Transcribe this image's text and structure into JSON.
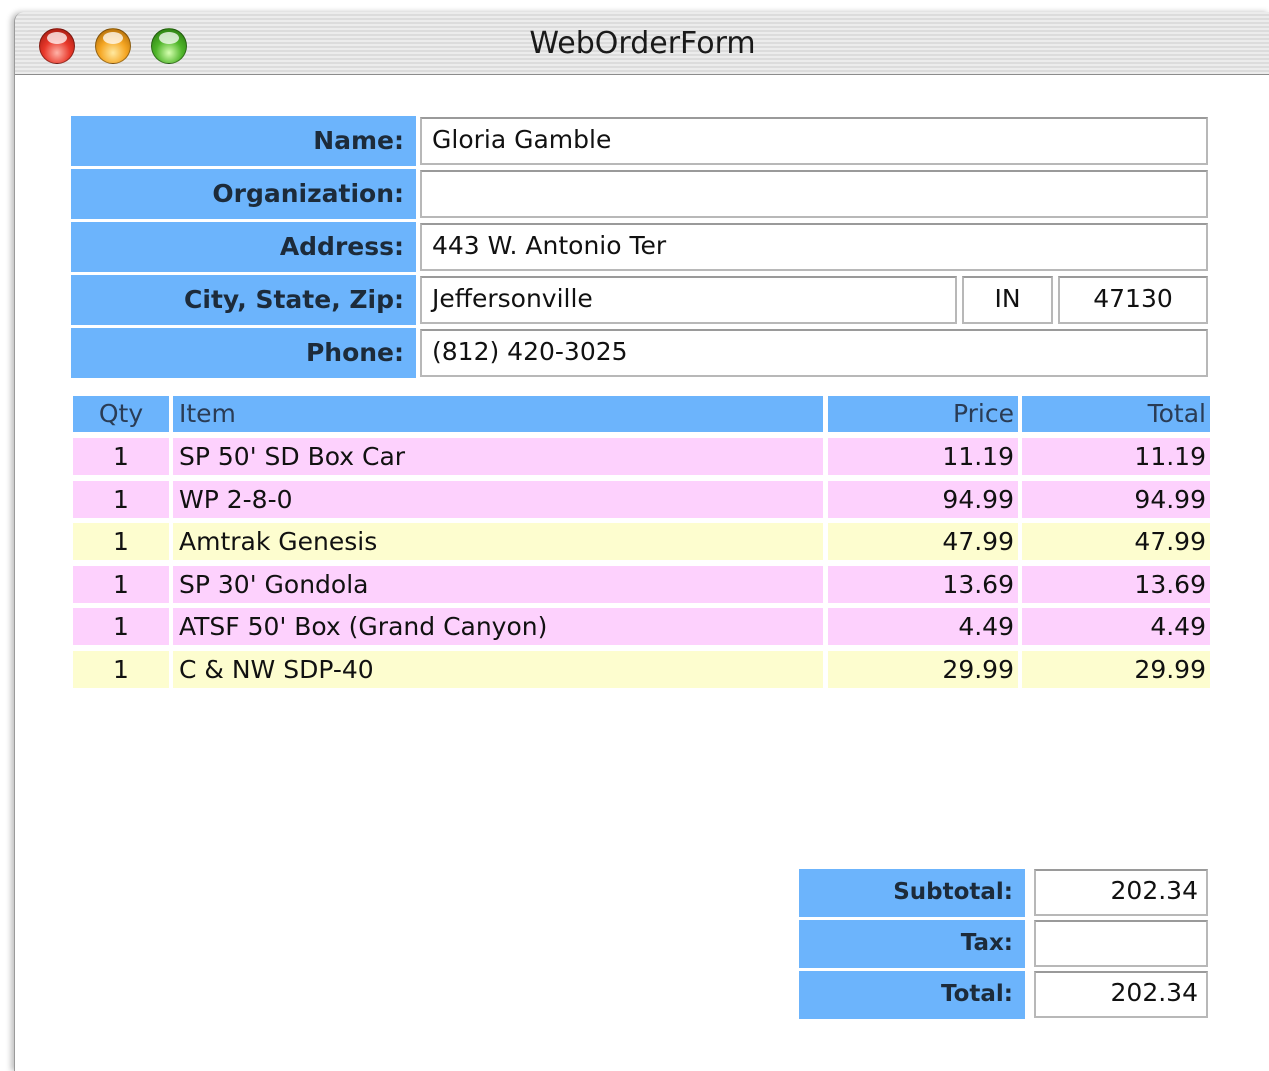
{
  "window": {
    "title": "WebOrderForm"
  },
  "customer": {
    "name_label": "Name:",
    "name_value": "Gloria Gamble",
    "organization_label": "Organization:",
    "organization_value": "",
    "address_label": "Address:",
    "address_value": "443 W. Antonio Ter",
    "csz_label": "City, State, Zip:",
    "city_value": "Jeffersonville",
    "state_value": "IN",
    "zip_value": "47130",
    "phone_label": "Phone:",
    "phone_value": "(812) 420-3025"
  },
  "items": {
    "headers": {
      "qty": "Qty",
      "item": "Item",
      "price": "Price",
      "total": "Total"
    },
    "rows": [
      {
        "qty": "1",
        "item": "SP 50' SD Box Car",
        "price": "11.19",
        "total": "11.19",
        "color": "#fdd1fd"
      },
      {
        "qty": "1",
        "item": "WP 2-8-0",
        "price": "94.99",
        "total": "94.99",
        "color": "#fdd1fd"
      },
      {
        "qty": "1",
        "item": "Amtrak Genesis",
        "price": "47.99",
        "total": "47.99",
        "color": "#fdfdcf"
      },
      {
        "qty": "1",
        "item": "SP 30' Gondola",
        "price": "13.69",
        "total": "13.69",
        "color": "#fdd1fd"
      },
      {
        "qty": "1",
        "item": "ATSF 50' Box (Grand Canyon)",
        "price": "4.49",
        "total": "4.49",
        "color": "#fdd1fd"
      },
      {
        "qty": "1",
        "item": "C & NW SDP-40",
        "price": "29.99",
        "total": "29.99",
        "color": "#fdfdcf"
      }
    ]
  },
  "totals": {
    "subtotal_label": "Subtotal:",
    "subtotal_value": "202.34",
    "tax_label": "Tax:",
    "tax_value": "",
    "total_label": "Total:",
    "total_value": "202.34"
  },
  "colors": {
    "label_blue": "#6cb4fc",
    "row_pink": "#fdd1fd",
    "row_yellow": "#fdfdcf"
  }
}
